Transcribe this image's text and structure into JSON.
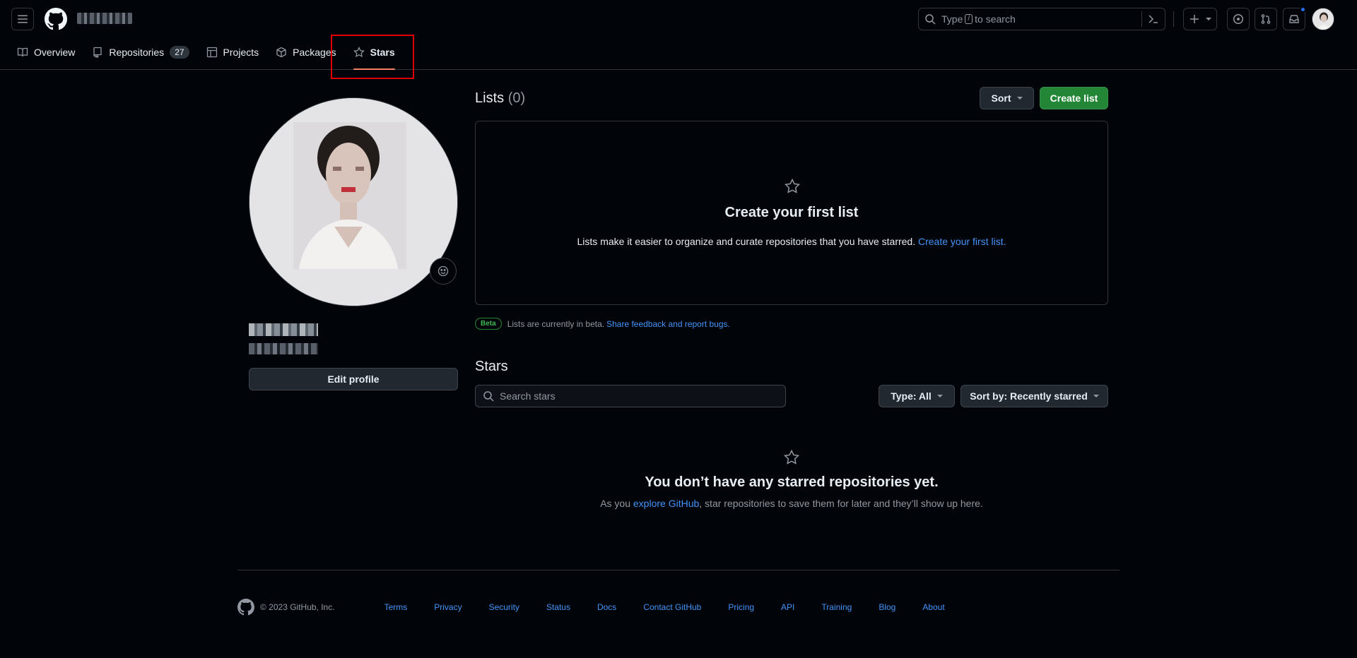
{
  "header": {
    "search_placeholder_prefix": "Type",
    "search_key": "/",
    "search_placeholder_suffix": "to search"
  },
  "nav": {
    "tabs": [
      {
        "label": "Overview"
      },
      {
        "label": "Repositories",
        "count": "27"
      },
      {
        "label": "Projects"
      },
      {
        "label": "Packages"
      },
      {
        "label": "Stars",
        "active": true
      }
    ]
  },
  "profile": {
    "edit_label": "Edit profile"
  },
  "lists": {
    "title": "Lists",
    "count": "(0)",
    "sort_label": "Sort",
    "create_label": "Create list",
    "blank_title": "Create your first list",
    "blank_text": "Lists make it easier to organize and curate repositories that you have starred.",
    "blank_link": "Create your first list.",
    "beta_badge": "Beta",
    "beta_text": "Lists are currently in beta.",
    "beta_link": "Share feedback and report bugs."
  },
  "stars": {
    "title": "Stars",
    "search_placeholder": "Search stars",
    "type_label": "Type: All",
    "sort_label": "Sort by: Recently starred",
    "empty_title": "You don’t have any starred repositories yet.",
    "empty_text_pre": "As you",
    "empty_link": "explore GitHub",
    "empty_text_post": ", star repositories to save them for later and they’ll show up here."
  },
  "footer": {
    "copyright": "© 2023 GitHub, Inc.",
    "links": [
      "Terms",
      "Privacy",
      "Security",
      "Status",
      "Docs",
      "Contact GitHub",
      "Pricing",
      "API",
      "Training",
      "Blog",
      "About"
    ]
  },
  "colors": {
    "accent_link": "#4493f8",
    "primary_button": "#238636",
    "active_tab_underline": "#f78166",
    "highlight_box": "#e00000"
  }
}
